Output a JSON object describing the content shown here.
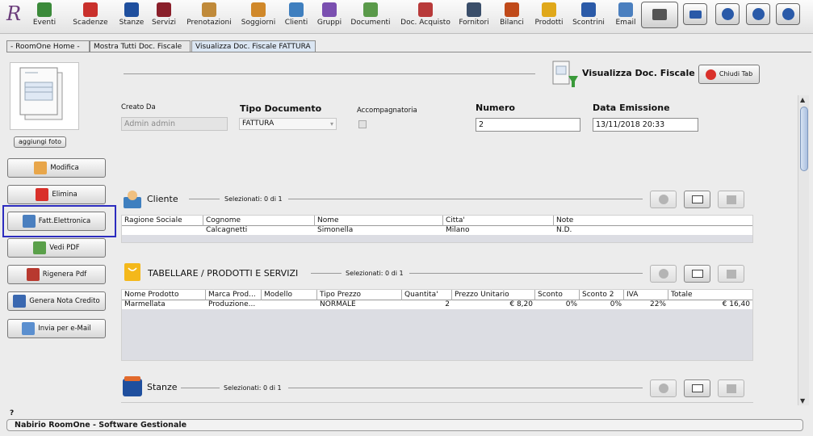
{
  "toolbar": {
    "items": [
      {
        "label": "Eventi",
        "icon": "calendar-plus-icon",
        "color": "#3b8a3a"
      },
      {
        "label": "Scadenze",
        "icon": "calendar-minus-icon",
        "color": "#c9302c"
      },
      {
        "label": "Stanze",
        "icon": "bed-icon",
        "color": "#1f4f9e"
      },
      {
        "label": "Servizi",
        "icon": "shirt-icon",
        "color": "#8a1f2a"
      },
      {
        "label": "Prenotazioni",
        "icon": "bell-icon",
        "color": "#c08a3a"
      },
      {
        "label": "Soggiorni",
        "icon": "suitcase-icon",
        "color": "#d0882a"
      },
      {
        "label": "Clienti",
        "icon": "client-icon",
        "color": "#3f7fbf"
      },
      {
        "label": "Gruppi",
        "icon": "group-icon",
        "color": "#7a4fb0"
      },
      {
        "label": "Documenti",
        "icon": "document-icon",
        "color": "#5a9a4a"
      },
      {
        "label": "Doc. Acquisto",
        "icon": "purchase-document-icon",
        "color": "#b83a3a"
      },
      {
        "label": "Fornitori",
        "icon": "supplier-icon",
        "color": "#3a4e6a"
      },
      {
        "label": "Bilanci",
        "icon": "balance-icon",
        "color": "#c04a1a"
      },
      {
        "label": "Prodotti",
        "icon": "product-icon",
        "color": "#e0a81a"
      },
      {
        "label": "Scontrini",
        "icon": "receipt-icon",
        "color": "#2a5aa8"
      },
      {
        "label": "Email",
        "icon": "email-icon",
        "color": "#4a7fbf"
      }
    ]
  },
  "tabs": [
    {
      "label": "- RoomOne Home -"
    },
    {
      "label": "Mostra Tutti Doc. Fiscale"
    },
    {
      "label": "Visualizza Doc. Fiscale FATTURA"
    }
  ],
  "sidebar": {
    "add_photo": "aggiungi foto",
    "buttons": [
      {
        "label": "Modifica",
        "icon": "edit-icon"
      },
      {
        "label": "Elimina",
        "icon": "delete-icon"
      },
      {
        "label": "Fatt.Elettronica",
        "icon": "electronic-invoice-icon"
      },
      {
        "label": "Vedi PDF",
        "icon": "pdf-view-icon"
      },
      {
        "label": "Rigenera Pdf",
        "icon": "pdf-regenerate-icon"
      },
      {
        "label": "Genera Nota Credito",
        "icon": "credit-note-icon"
      },
      {
        "label": "Invia per e-Mail",
        "icon": "send-email-icon"
      }
    ]
  },
  "header": {
    "title": "Visualizza Doc. Fiscale",
    "close_tab": "Chiudi Tab"
  },
  "form": {
    "creato_da_label": "Creato Da",
    "creato_da_value": "Admin admin",
    "tipo_documento_label": "Tipo Documento",
    "tipo_documento_value": "FATTURA",
    "accompagnatoria_label": "Accompagnatoria",
    "numero_label": "Numero",
    "numero_value": "2",
    "data_emissione_label": "Data Emissione",
    "data_emissione_value": "13/11/2018 20:33"
  },
  "cliente": {
    "title": "Cliente",
    "selected": "Selezionati:  0 di 1",
    "columns": [
      "Ragione Sociale",
      "Cognome",
      "Nome",
      "Citta'",
      "Note"
    ],
    "rows": [
      [
        "",
        "Calcagnetti",
        "Simonella",
        "Milano",
        "N.D."
      ]
    ]
  },
  "prodotti": {
    "title": "TABELLARE / PRODOTTI E SERVIZI",
    "selected": "Selezionati:  0 di 1",
    "columns": [
      "Nome Prodotto",
      "Marca Prod...",
      "Modello",
      "Tipo Prezzo",
      "Quantita'",
      "Prezzo Unitario",
      "Sconto",
      "Sconto 2",
      "IVA",
      "Totale"
    ],
    "rows": [
      [
        "Marmellata",
        "Produzione...",
        "",
        "NORMALE",
        "2",
        "€ 8,20",
        "0%",
        "0%",
        "22%",
        "€ 16,40"
      ]
    ]
  },
  "stanze": {
    "title": "Stanze",
    "selected": "Selezionati:  0 di 1"
  },
  "status": {
    "help": "?",
    "text": "Nabirio RoomOne - Software Gestionale"
  }
}
